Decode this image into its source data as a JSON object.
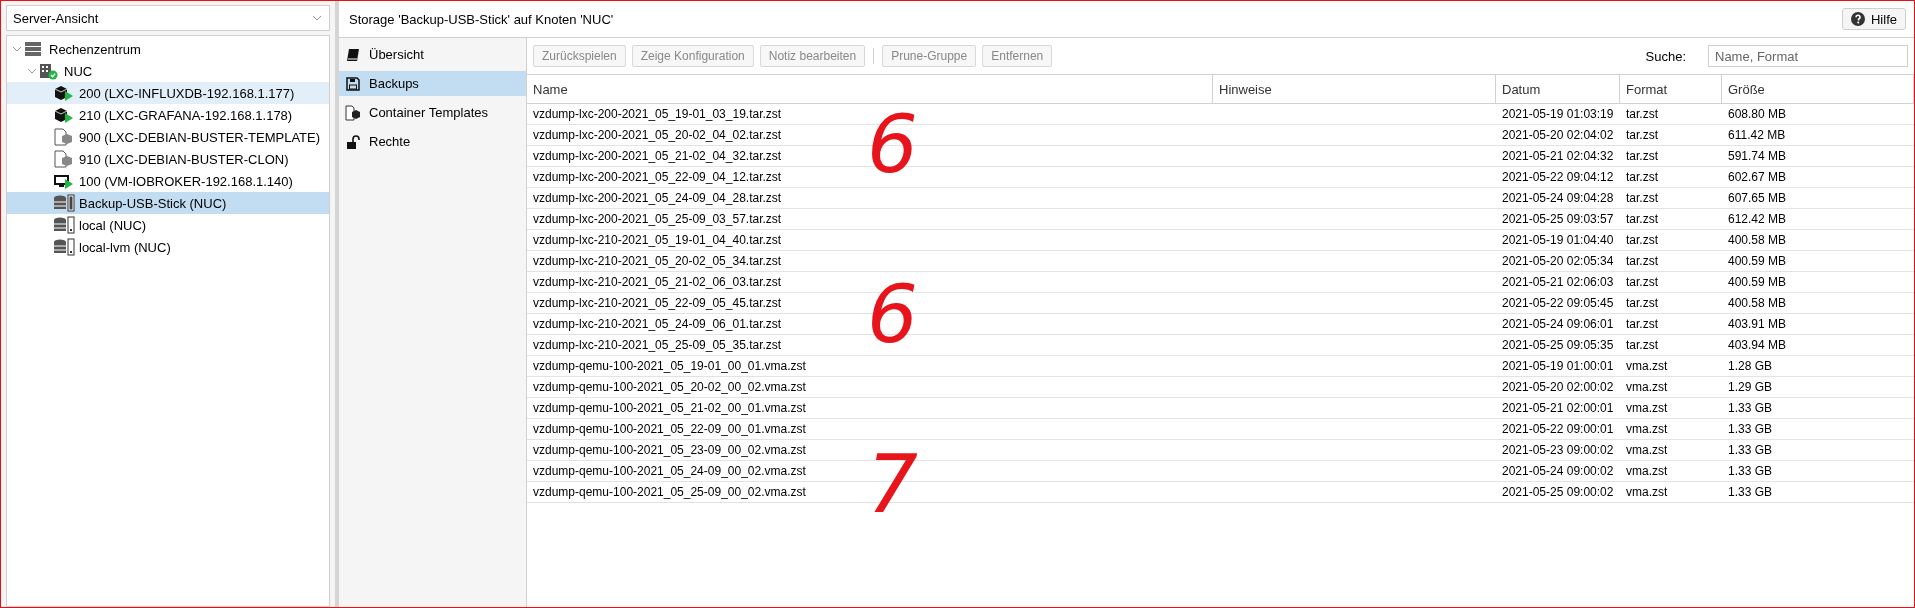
{
  "view_selector": {
    "value": "Server-Ansicht"
  },
  "tree": [
    {
      "label": "Rechenzentrum",
      "kind": "datacenter",
      "expanded": true,
      "selected": false,
      "hovered": false,
      "children": [
        {
          "label": "NUC",
          "kind": "node",
          "expanded": true,
          "selected": false,
          "hovered": false,
          "children": [
            {
              "label": "200 (LXC-INFLUXDB-192.168.1.177)",
              "kind": "container-running",
              "selected": false,
              "hovered": true
            },
            {
              "label": "210 (LXC-GRAFANA-192.168.1.178)",
              "kind": "container-running",
              "selected": false,
              "hovered": false
            },
            {
              "label": "900 (LXC-DEBIAN-BUSTER-TEMPLATE)",
              "kind": "template",
              "selected": false,
              "hovered": false
            },
            {
              "label": "910 (LXC-DEBIAN-BUSTER-CLON)",
              "kind": "template",
              "selected": false,
              "hovered": false
            },
            {
              "label": "100 (VM-IOBROKER-192.168.1.140)",
              "kind": "vm-running",
              "selected": false,
              "hovered": false
            },
            {
              "label": "Backup-USB-Stick (NUC)",
              "kind": "storage-usb",
              "selected": true,
              "hovered": false
            },
            {
              "label": "local (NUC)",
              "kind": "storage",
              "selected": false,
              "hovered": false
            },
            {
              "label": "local-lvm (NUC)",
              "kind": "storage",
              "selected": false,
              "hovered": false
            }
          ]
        }
      ]
    }
  ],
  "header": {
    "title": "Storage 'Backup-USB-Stick' auf Knoten 'NUC'",
    "help_button": "Hilfe"
  },
  "nav": [
    {
      "label": "Übersicht",
      "kind": "book",
      "selected": false
    },
    {
      "label": "Backups",
      "kind": "floppy",
      "selected": true
    },
    {
      "label": "Container Templates",
      "kind": "template",
      "selected": false
    },
    {
      "label": "Rechte",
      "kind": "lock",
      "selected": false
    }
  ],
  "toolbar": {
    "groups": [
      [
        {
          "label": "Zurückspielen",
          "disabled": true
        },
        {
          "label": "Zeige Konfiguration",
          "disabled": true
        },
        {
          "label": "Notiz bearbeiten",
          "disabled": true
        }
      ],
      [
        {
          "label": "Prune-Gruppe",
          "disabled": true
        },
        {
          "label": "Entfernen",
          "disabled": true
        }
      ]
    ],
    "search_label": "Suche:",
    "search": {
      "placeholder": "Name, Format"
    }
  },
  "table": {
    "columns": [
      "Name",
      "Hinweise",
      "Datum",
      "Format",
      "Größe"
    ],
    "rows": [
      [
        "vzdump-lxc-200-2021_05_19-01_03_19.tar.zst",
        "",
        "2021-05-19 01:03:19",
        "tar.zst",
        "608.80 MB"
      ],
      [
        "vzdump-lxc-200-2021_05_20-02_04_02.tar.zst",
        "",
        "2021-05-20 02:04:02",
        "tar.zst",
        "611.42 MB"
      ],
      [
        "vzdump-lxc-200-2021_05_21-02_04_32.tar.zst",
        "",
        "2021-05-21 02:04:32",
        "tar.zst",
        "591.74 MB"
      ],
      [
        "vzdump-lxc-200-2021_05_22-09_04_12.tar.zst",
        "",
        "2021-05-22 09:04:12",
        "tar.zst",
        "602.67 MB"
      ],
      [
        "vzdump-lxc-200-2021_05_24-09_04_28.tar.zst",
        "",
        "2021-05-24 09:04:28",
        "tar.zst",
        "607.65 MB"
      ],
      [
        "vzdump-lxc-200-2021_05_25-09_03_57.tar.zst",
        "",
        "2021-05-25 09:03:57",
        "tar.zst",
        "612.42 MB"
      ],
      [
        "vzdump-lxc-210-2021_05_19-01_04_40.tar.zst",
        "",
        "2021-05-19 01:04:40",
        "tar.zst",
        "400.58 MB"
      ],
      [
        "vzdump-lxc-210-2021_05_20-02_05_34.tar.zst",
        "",
        "2021-05-20 02:05:34",
        "tar.zst",
        "400.59 MB"
      ],
      [
        "vzdump-lxc-210-2021_05_21-02_06_03.tar.zst",
        "",
        "2021-05-21 02:06:03",
        "tar.zst",
        "400.59 MB"
      ],
      [
        "vzdump-lxc-210-2021_05_22-09_05_45.tar.zst",
        "",
        "2021-05-22 09:05:45",
        "tar.zst",
        "400.58 MB"
      ],
      [
        "vzdump-lxc-210-2021_05_24-09_06_01.tar.zst",
        "",
        "2021-05-24 09:06:01",
        "tar.zst",
        "403.91 MB"
      ],
      [
        "vzdump-lxc-210-2021_05_25-09_05_35.tar.zst",
        "",
        "2021-05-25 09:05:35",
        "tar.zst",
        "403.94 MB"
      ],
      [
        "vzdump-qemu-100-2021_05_19-01_00_01.vma.zst",
        "",
        "2021-05-19 01:00:01",
        "vma.zst",
        "1.28 GB"
      ],
      [
        "vzdump-qemu-100-2021_05_20-02_00_02.vma.zst",
        "",
        "2021-05-20 02:00:02",
        "vma.zst",
        "1.29 GB"
      ],
      [
        "vzdump-qemu-100-2021_05_21-02_00_01.vma.zst",
        "",
        "2021-05-21 02:00:01",
        "vma.zst",
        "1.33 GB"
      ],
      [
        "vzdump-qemu-100-2021_05_22-09_00_01.vma.zst",
        "",
        "2021-05-22 09:00:01",
        "vma.zst",
        "1.33 GB"
      ],
      [
        "vzdump-qemu-100-2021_05_23-09_00_02.vma.zst",
        "",
        "2021-05-23 09:00:02",
        "vma.zst",
        "1.33 GB"
      ],
      [
        "vzdump-qemu-100-2021_05_24-09_00_02.vma.zst",
        "",
        "2021-05-24 09:00:02",
        "vma.zst",
        "1.33 GB"
      ],
      [
        "vzdump-qemu-100-2021_05_25-09_00_02.vma.zst",
        "",
        "2021-05-25 09:00:02",
        "vma.zst",
        "1.33 GB"
      ]
    ]
  },
  "annotations": [
    {
      "text": "6",
      "color": "#e8141c"
    },
    {
      "text": "6",
      "color": "#e8141c"
    },
    {
      "text": "7",
      "color": "#e8141c"
    }
  ]
}
